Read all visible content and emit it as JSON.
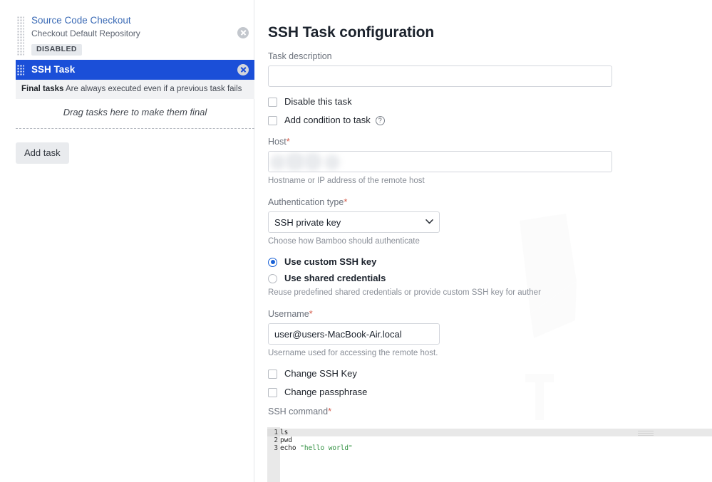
{
  "tasks_panel": {
    "tasks": [
      {
        "title": "Source Code Checkout",
        "subtitle": "Checkout Default Repository",
        "badge": "DISABLED",
        "selected": false,
        "remove_label": "remove-task"
      },
      {
        "title": "SSH Task",
        "subtitle": "",
        "badge": "",
        "selected": true,
        "remove_label": "remove-task"
      }
    ],
    "final_tasks": {
      "heading": "Final tasks",
      "description": "Are always executed even if a previous task fails",
      "dropzone_text": "Drag tasks here to make them final"
    },
    "add_task_label": "Add task"
  },
  "config": {
    "page_title": "SSH Task configuration",
    "task_description": {
      "label": "Task description",
      "value": "",
      "placeholder": ""
    },
    "disable_task": {
      "label": "Disable this task",
      "checked": false
    },
    "add_condition": {
      "label": "Add condition to task",
      "checked": false,
      "help_glyph": "?"
    },
    "host": {
      "label": "Host",
      "required_marker": "*",
      "value": "",
      "helper": "Hostname or IP address of the remote host"
    },
    "auth_type": {
      "label": "Authentication type",
      "required_marker": "*",
      "selected": "SSH private key",
      "options": [
        "SSH private key"
      ],
      "helper": "Choose how Bamboo should authenticate"
    },
    "credentials": {
      "custom_key_label": "Use custom SSH key",
      "shared_label": "Use shared credentials",
      "selected": "custom",
      "helper": "Reuse predefined shared credentials or provide custom SSH key for auther"
    },
    "username": {
      "label": "Username",
      "required_marker": "*",
      "value": "user@users-MacBook-Air.local",
      "helper": "Username used for accessing the remote host."
    },
    "change_ssh_key": {
      "label": "Change SSH Key",
      "checked": false
    },
    "change_passphrase": {
      "label": "Change passphrase",
      "checked": false
    },
    "ssh_command": {
      "label": "SSH command",
      "required_marker": "*",
      "lines": [
        {
          "number": "1",
          "code": "ls",
          "string": ""
        },
        {
          "number": "2",
          "code": "pwd",
          "string": ""
        },
        {
          "number": "3",
          "code": "echo ",
          "string": "\"hello world\""
        }
      ],
      "active_line": 1
    }
  },
  "colors": {
    "selected_task_blue": "#1b4fd8",
    "link_blue": "#3a6ab5",
    "required_red": "#d45b4a",
    "radio_blue": "#1b62d6",
    "string_green": "#2f8f3f"
  }
}
